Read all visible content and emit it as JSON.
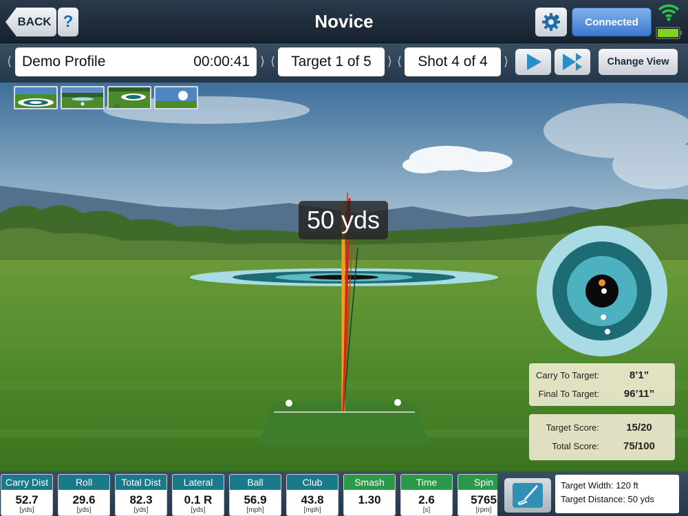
{
  "header": {
    "back_label": "BACK",
    "help_label": "?",
    "title": "Novice",
    "connected_label": "Connected"
  },
  "session": {
    "profile_name": "Demo Profile",
    "timer": "00:00:41",
    "target_label": "Target 1 of 5",
    "shot_label": "Shot 4 of 4",
    "change_view_label": "Change View",
    "chevron_left": "⟨",
    "chevron_right": "⟩"
  },
  "scene": {
    "distance_label": "50 yds",
    "view_thumbnails": [
      "target-view",
      "range-view",
      "down-range-view",
      "ball-view"
    ]
  },
  "scores": {
    "carry_to_target_label": "Carry To Target:",
    "carry_to_target_value": "8’1”",
    "final_to_target_label": "Final To Target:",
    "final_to_target_value": "96’11”",
    "target_score_label": "Target Score:",
    "target_score_value": "15/20",
    "total_score_label": "Total Score:",
    "total_score_value": "75/100"
  },
  "stats": [
    {
      "label": "Carry Dist",
      "value": "52.7",
      "unit": "[yds]",
      "color": "#1b7a8a"
    },
    {
      "label": "Roll",
      "value": "29.6",
      "unit": "[yds]",
      "color": "#1b7a8a"
    },
    {
      "label": "Total Dist",
      "value": "82.3",
      "unit": "[yds]",
      "color": "#1b7a8a"
    },
    {
      "label": "Lateral",
      "value": "0.1 R",
      "unit": "[yds]",
      "color": "#1b7a8a"
    },
    {
      "label": "Ball",
      "value": "56.9",
      "unit": "[mph]",
      "color": "#1b7a8a"
    },
    {
      "label": "Club",
      "value": "43.8",
      "unit": "[mph]",
      "color": "#1b7a8a"
    },
    {
      "label": "Smash",
      "value": "1.30",
      "unit": "",
      "color": "#2a9a4a"
    },
    {
      "label": "Time",
      "value": "2.6",
      "unit": "[s]",
      "color": "#2a9a4a"
    },
    {
      "label": "Spin",
      "value": "5765",
      "unit": "[rpm]",
      "color": "#2a9a4a"
    }
  ],
  "target_info": {
    "width_text": "Target Width: 120 ft",
    "distance_text": "Target Distance: 50 yds"
  },
  "icons": {
    "settings": "gear-icon",
    "wifi": "wifi-icon",
    "battery": "battery-icon",
    "play": "play-icon",
    "fast_forward": "fast-forward-icon",
    "club": "golf-club-icon"
  },
  "colors": {
    "accent_teal": "#1b7a8a",
    "accent_green": "#2a9a4a",
    "connected_blue": "#4a86d6",
    "trajectory_orange": "#f0a020",
    "trajectory_red": "#e02010"
  }
}
